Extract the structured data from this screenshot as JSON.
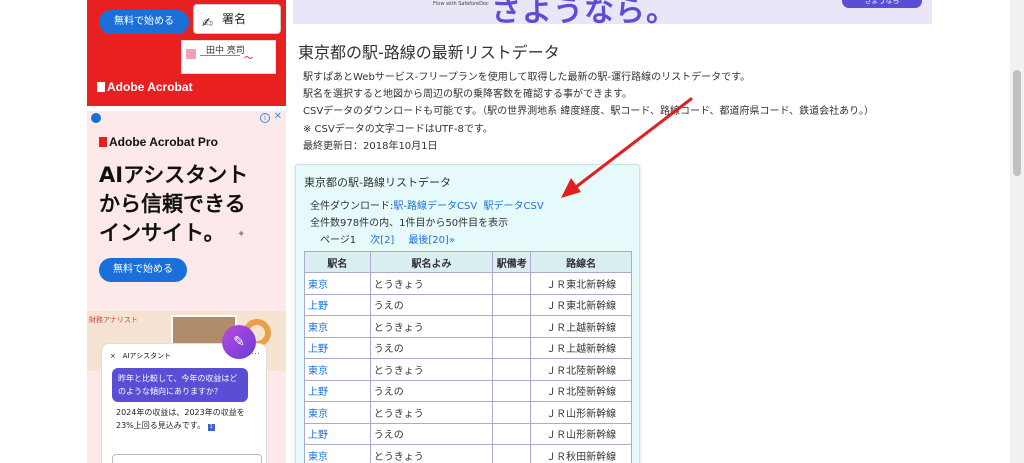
{
  "ads": {
    "ad1": {
      "start_label": "無料で始める",
      "sign_label": "署名",
      "doc_name": "田中 亮司",
      "brand": "Adobe Acrobat"
    },
    "ad2": {
      "brand": "Adobe Acrobat Pro",
      "headline_1": "AIアシスタント",
      "headline_2": "から信頼できる",
      "headline_3": "インサイト。",
      "start_label": "無料で始める",
      "collage_label": "財務アナリスト",
      "panel_title": "AIアシスタント",
      "panel_close": "×",
      "panel_menu": "…",
      "question": "昨年と比較して、今年の収益はどのような傾向にありますか？",
      "answer": "2024年の収益は、2023年の収益を23%上回る見込みです。",
      "footnote": "1"
    }
  },
  "banner": {
    "small_text": "Flow with SafeforeDoc",
    "big_text": "さようなら。",
    "cta": "さようなら"
  },
  "main": {
    "title": "東京都の駅-路線の最新リストデータ",
    "description": [
      "駅すぱあとWebサービス-フリープランを使用して取得した最新の駅-運行路線のリストデータです。",
      "駅名を選択すると地図から周辺の駅の乗降客数を確認する事ができます。",
      "CSVデータのダウンロードも可能です。（駅の世界測地系 緯度経度、駅コード、路線コード、都道府県コード、鉄道会社あり。）",
      "※ CSVデータの文字コードはUTF-8です。",
      "最終更新日：2018年10月1日"
    ]
  },
  "box": {
    "title": "東京都の駅-路線リストデータ",
    "download_prefix": "全件ダウンロード:",
    "download_link1": "駅-路線データCSV",
    "download_link2": "駅データCSV",
    "count_text": "全件数978件の内、1件目から50件目を表示",
    "page_label": "ページ1",
    "next_label": "次[2]",
    "last_label": "最後[20]»"
  },
  "table": {
    "headers": [
      "駅名",
      "駅名よみ",
      "駅備考",
      "路線名"
    ],
    "rows": [
      [
        "東京",
        "とうきょう",
        "",
        "ＪＲ東北新幹線"
      ],
      [
        "上野",
        "うえの",
        "",
        "ＪＲ東北新幹線"
      ],
      [
        "東京",
        "とうきょう",
        "",
        "ＪＲ上越新幹線"
      ],
      [
        "上野",
        "うえの",
        "",
        "ＪＲ上越新幹線"
      ],
      [
        "東京",
        "とうきょう",
        "",
        "ＪＲ北陸新幹線"
      ],
      [
        "上野",
        "うえの",
        "",
        "ＪＲ北陸新幹線"
      ],
      [
        "東京",
        "とうきょう",
        "",
        "ＪＲ山形新幹線"
      ],
      [
        "上野",
        "うえの",
        "",
        "ＪＲ山形新幹線"
      ],
      [
        "東京",
        "とうきょう",
        "",
        "ＪＲ秋田新幹線"
      ]
    ]
  },
  "colors": {
    "link": "#1a73d9",
    "arrow": "#e02020",
    "box_bg": "#e6fafb",
    "ad_red": "#e8201f",
    "ad_blue": "#1a6fd9"
  },
  "icons": [
    "pen-icon",
    "info-icon",
    "adchoices-icon",
    "close-icon",
    "ai-sparkle-icon",
    "red-arrow-annotation"
  ]
}
